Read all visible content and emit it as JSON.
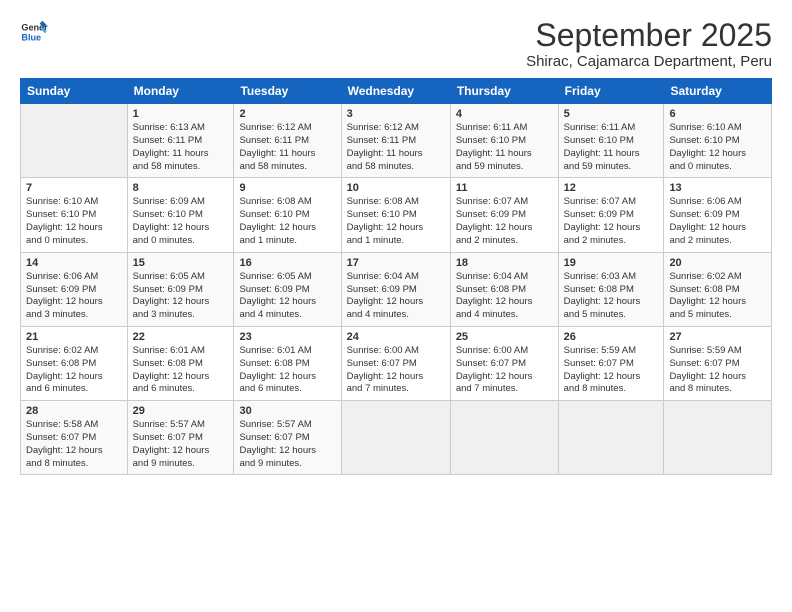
{
  "logo": {
    "line1": "General",
    "line2": "Blue"
  },
  "header": {
    "month": "September 2025",
    "location": "Shirac, Cajamarca Department, Peru"
  },
  "days_of_week": [
    "Sunday",
    "Monday",
    "Tuesday",
    "Wednesday",
    "Thursday",
    "Friday",
    "Saturday"
  ],
  "weeks": [
    [
      {
        "day": "",
        "info": ""
      },
      {
        "day": "1",
        "info": "Sunrise: 6:13 AM\nSunset: 6:11 PM\nDaylight: 11 hours\nand 58 minutes."
      },
      {
        "day": "2",
        "info": "Sunrise: 6:12 AM\nSunset: 6:11 PM\nDaylight: 11 hours\nand 58 minutes."
      },
      {
        "day": "3",
        "info": "Sunrise: 6:12 AM\nSunset: 6:11 PM\nDaylight: 11 hours\nand 58 minutes."
      },
      {
        "day": "4",
        "info": "Sunrise: 6:11 AM\nSunset: 6:10 PM\nDaylight: 11 hours\nand 59 minutes."
      },
      {
        "day": "5",
        "info": "Sunrise: 6:11 AM\nSunset: 6:10 PM\nDaylight: 11 hours\nand 59 minutes."
      },
      {
        "day": "6",
        "info": "Sunrise: 6:10 AM\nSunset: 6:10 PM\nDaylight: 12 hours\nand 0 minutes."
      }
    ],
    [
      {
        "day": "7",
        "info": "Sunrise: 6:10 AM\nSunset: 6:10 PM\nDaylight: 12 hours\nand 0 minutes."
      },
      {
        "day": "8",
        "info": "Sunrise: 6:09 AM\nSunset: 6:10 PM\nDaylight: 12 hours\nand 0 minutes."
      },
      {
        "day": "9",
        "info": "Sunrise: 6:08 AM\nSunset: 6:10 PM\nDaylight: 12 hours\nand 1 minute."
      },
      {
        "day": "10",
        "info": "Sunrise: 6:08 AM\nSunset: 6:10 PM\nDaylight: 12 hours\nand 1 minute."
      },
      {
        "day": "11",
        "info": "Sunrise: 6:07 AM\nSunset: 6:09 PM\nDaylight: 12 hours\nand 2 minutes."
      },
      {
        "day": "12",
        "info": "Sunrise: 6:07 AM\nSunset: 6:09 PM\nDaylight: 12 hours\nand 2 minutes."
      },
      {
        "day": "13",
        "info": "Sunrise: 6:06 AM\nSunset: 6:09 PM\nDaylight: 12 hours\nand 2 minutes."
      }
    ],
    [
      {
        "day": "14",
        "info": "Sunrise: 6:06 AM\nSunset: 6:09 PM\nDaylight: 12 hours\nand 3 minutes."
      },
      {
        "day": "15",
        "info": "Sunrise: 6:05 AM\nSunset: 6:09 PM\nDaylight: 12 hours\nand 3 minutes."
      },
      {
        "day": "16",
        "info": "Sunrise: 6:05 AM\nSunset: 6:09 PM\nDaylight: 12 hours\nand 4 minutes."
      },
      {
        "day": "17",
        "info": "Sunrise: 6:04 AM\nSunset: 6:09 PM\nDaylight: 12 hours\nand 4 minutes."
      },
      {
        "day": "18",
        "info": "Sunrise: 6:04 AM\nSunset: 6:08 PM\nDaylight: 12 hours\nand 4 minutes."
      },
      {
        "day": "19",
        "info": "Sunrise: 6:03 AM\nSunset: 6:08 PM\nDaylight: 12 hours\nand 5 minutes."
      },
      {
        "day": "20",
        "info": "Sunrise: 6:02 AM\nSunset: 6:08 PM\nDaylight: 12 hours\nand 5 minutes."
      }
    ],
    [
      {
        "day": "21",
        "info": "Sunrise: 6:02 AM\nSunset: 6:08 PM\nDaylight: 12 hours\nand 6 minutes."
      },
      {
        "day": "22",
        "info": "Sunrise: 6:01 AM\nSunset: 6:08 PM\nDaylight: 12 hours\nand 6 minutes."
      },
      {
        "day": "23",
        "info": "Sunrise: 6:01 AM\nSunset: 6:08 PM\nDaylight: 12 hours\nand 6 minutes."
      },
      {
        "day": "24",
        "info": "Sunrise: 6:00 AM\nSunset: 6:07 PM\nDaylight: 12 hours\nand 7 minutes."
      },
      {
        "day": "25",
        "info": "Sunrise: 6:00 AM\nSunset: 6:07 PM\nDaylight: 12 hours\nand 7 minutes."
      },
      {
        "day": "26",
        "info": "Sunrise: 5:59 AM\nSunset: 6:07 PM\nDaylight: 12 hours\nand 8 minutes."
      },
      {
        "day": "27",
        "info": "Sunrise: 5:59 AM\nSunset: 6:07 PM\nDaylight: 12 hours\nand 8 minutes."
      }
    ],
    [
      {
        "day": "28",
        "info": "Sunrise: 5:58 AM\nSunset: 6:07 PM\nDaylight: 12 hours\nand 8 minutes."
      },
      {
        "day": "29",
        "info": "Sunrise: 5:57 AM\nSunset: 6:07 PM\nDaylight: 12 hours\nand 9 minutes."
      },
      {
        "day": "30",
        "info": "Sunrise: 5:57 AM\nSunset: 6:07 PM\nDaylight: 12 hours\nand 9 minutes."
      },
      {
        "day": "",
        "info": ""
      },
      {
        "day": "",
        "info": ""
      },
      {
        "day": "",
        "info": ""
      },
      {
        "day": "",
        "info": ""
      }
    ]
  ]
}
